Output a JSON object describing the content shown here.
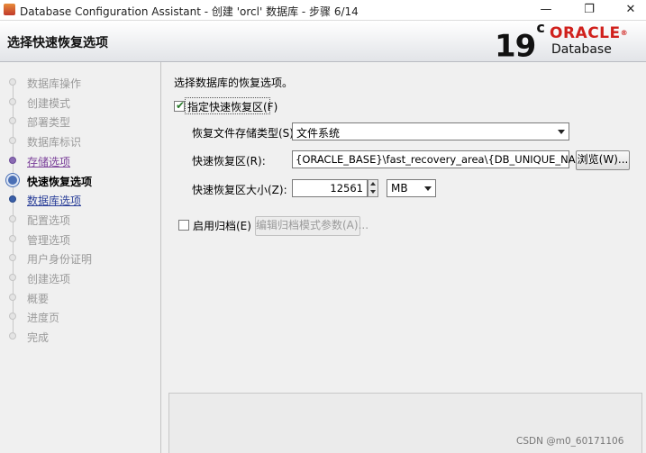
{
  "window": {
    "title": "Database Configuration Assistant - 创建 'orcl' 数据库 - 步骤 6/14",
    "controls": {
      "minimize": "—",
      "maximize": "❐",
      "close": "✕"
    }
  },
  "header": {
    "step_title": "选择快速恢复选项",
    "logo": {
      "version": "19",
      "version_suffix": "c",
      "brand": "ORACLE",
      "brand_mark": "®",
      "product": "Database"
    }
  },
  "nav": {
    "items": [
      {
        "label": "数据库操作",
        "state": "done"
      },
      {
        "label": "创建模式",
        "state": "done"
      },
      {
        "label": "部署类型",
        "state": "done"
      },
      {
        "label": "数据库标识",
        "state": "done"
      },
      {
        "label": "存储选项",
        "state": "visited"
      },
      {
        "label": "快速恢复选项",
        "state": "current"
      },
      {
        "label": "数据库选项",
        "state": "next"
      },
      {
        "label": "配置选项",
        "state": "pending"
      },
      {
        "label": "管理选项",
        "state": "pending"
      },
      {
        "label": "用户身份证明",
        "state": "pending"
      },
      {
        "label": "创建选项",
        "state": "pending"
      },
      {
        "label": "概要",
        "state": "pending"
      },
      {
        "label": "进度页",
        "state": "pending"
      },
      {
        "label": "完成",
        "state": "pending"
      }
    ]
  },
  "form": {
    "intro": "选择数据库的恢复选项。",
    "fra_checkbox": {
      "label": "指定快速恢复区(F)",
      "checked": true
    },
    "storage_type": {
      "label": "恢复文件存储类型(S):",
      "value": "文件系统"
    },
    "fra_location": {
      "label": "快速恢复区(R):",
      "value": "{ORACLE_BASE}\\fast_recovery_area\\{DB_UNIQUE_NAME}",
      "browse": "浏览(W)..."
    },
    "fra_size": {
      "label": "快速恢复区大小(Z):",
      "value": "12561",
      "unit": "MB"
    },
    "archive_checkbox": {
      "label": "启用归档(E)",
      "checked": false
    },
    "archive_button": "编辑归档模式参数(A)..."
  },
  "watermark": "CSDN @m0_60171106"
}
